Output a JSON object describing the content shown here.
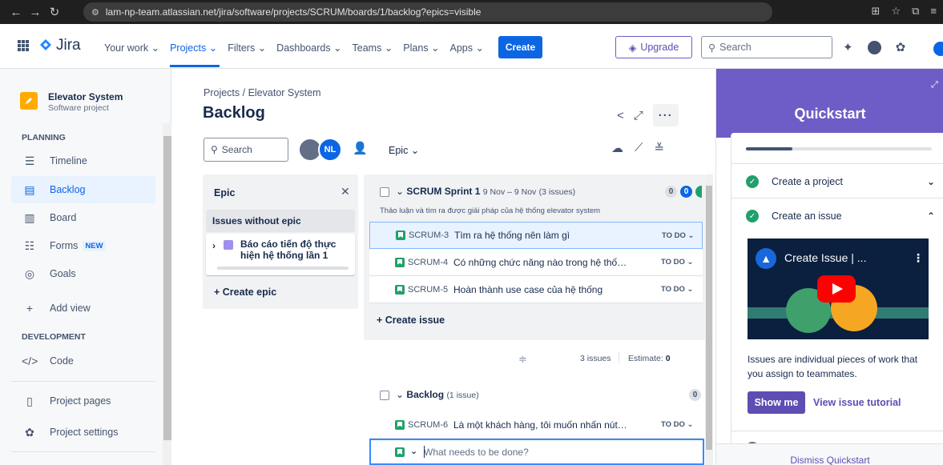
{
  "browser": {
    "url": "lam-np-team.atlassian.net/jira/software/projects/SCRUM/boards/1/backlog?epics=visible"
  },
  "topnav": {
    "logo": "Jira",
    "items": [
      "Your work ⌄",
      "Projects ⌄",
      "Filters ⌄",
      "Dashboards ⌄",
      "Teams ⌄",
      "Plans ⌄",
      "Apps ⌄"
    ],
    "create": "Create",
    "upgrade": "Upgrade",
    "search_placeholder": "Search"
  },
  "sidebar": {
    "project_name": "Elevator System",
    "project_type": "Software project",
    "planning_heading": "PLANNING",
    "items": [
      {
        "label": "Timeline",
        "icon": "timeline-icon"
      },
      {
        "label": "Backlog",
        "icon": "backlog-icon"
      },
      {
        "label": "Board",
        "icon": "board-icon"
      },
      {
        "label": "Forms",
        "icon": "forms-icon"
      },
      {
        "label": "Goals",
        "icon": "goals-icon"
      },
      {
        "label": "Add view",
        "icon": "plus-icon"
      }
    ],
    "forms_badge": "NEW",
    "development_heading": "DEVELOPMENT",
    "code": "Code",
    "project_pages": "Project pages",
    "project_settings": "Project settings"
  },
  "main": {
    "breadcrumb": "Projects  /  Elevator System",
    "title": "Backlog",
    "search_placeholder": "Search",
    "avatar_initials": "NL",
    "epic_filter": "Epic  ⌄"
  },
  "epic_panel": {
    "title": "Epic",
    "without_epic": "Issues without epic",
    "epic_name": "Báo cáo tiến độ thực hiện hệ thống lần 1",
    "create_epic": "+ Create epic"
  },
  "sprint": {
    "name": "SCRUM Sprint 1",
    "dates": "9 Nov – 9 Nov",
    "count": "(3 issues)",
    "goal": "Thảo luận và tìm ra được giải pháp của hệ thống elevator system",
    "pills": [
      "0",
      "0"
    ],
    "issues": [
      {
        "key": "SCRUM-3",
        "summary": "Tìm ra hệ thống nên làm gì",
        "status": "TO DO ⌄"
      },
      {
        "key": "SCRUM-4",
        "summary": "Có những chức năng nào trong hệ thố…",
        "status": "TO DO ⌄"
      },
      {
        "key": "SCRUM-5",
        "summary": "Hoàn thành use case của hệ thống",
        "status": "TO DO ⌄"
      }
    ],
    "create_issue": "+ Create issue",
    "summary_issues": "3 issues",
    "estimate_label": "Estimate:",
    "estimate_value": "0"
  },
  "backlog": {
    "name": "Backlog",
    "count": "(1 issue)",
    "pill": "0",
    "issues": [
      {
        "key": "SCRUM-6",
        "summary": "Là một khách hàng, tôi muốn nhấn nút…",
        "status": "TO DO ⌄"
      }
    ],
    "new_issue_placeholder": "What needs to be done?"
  },
  "quickstart": {
    "title": "Quickstart",
    "progress": 0.25,
    "tasks": [
      {
        "label": "Create a project",
        "done": true
      },
      {
        "label": "Create an issue",
        "done": true
      }
    ],
    "video_title": "Create Issue | ...",
    "description": "Issues are individual pieces of work that you assign to teammates.",
    "show_me": "Show me",
    "view_tutorial": "View issue tutorial",
    "dismiss": "Dismiss Quickstart"
  }
}
